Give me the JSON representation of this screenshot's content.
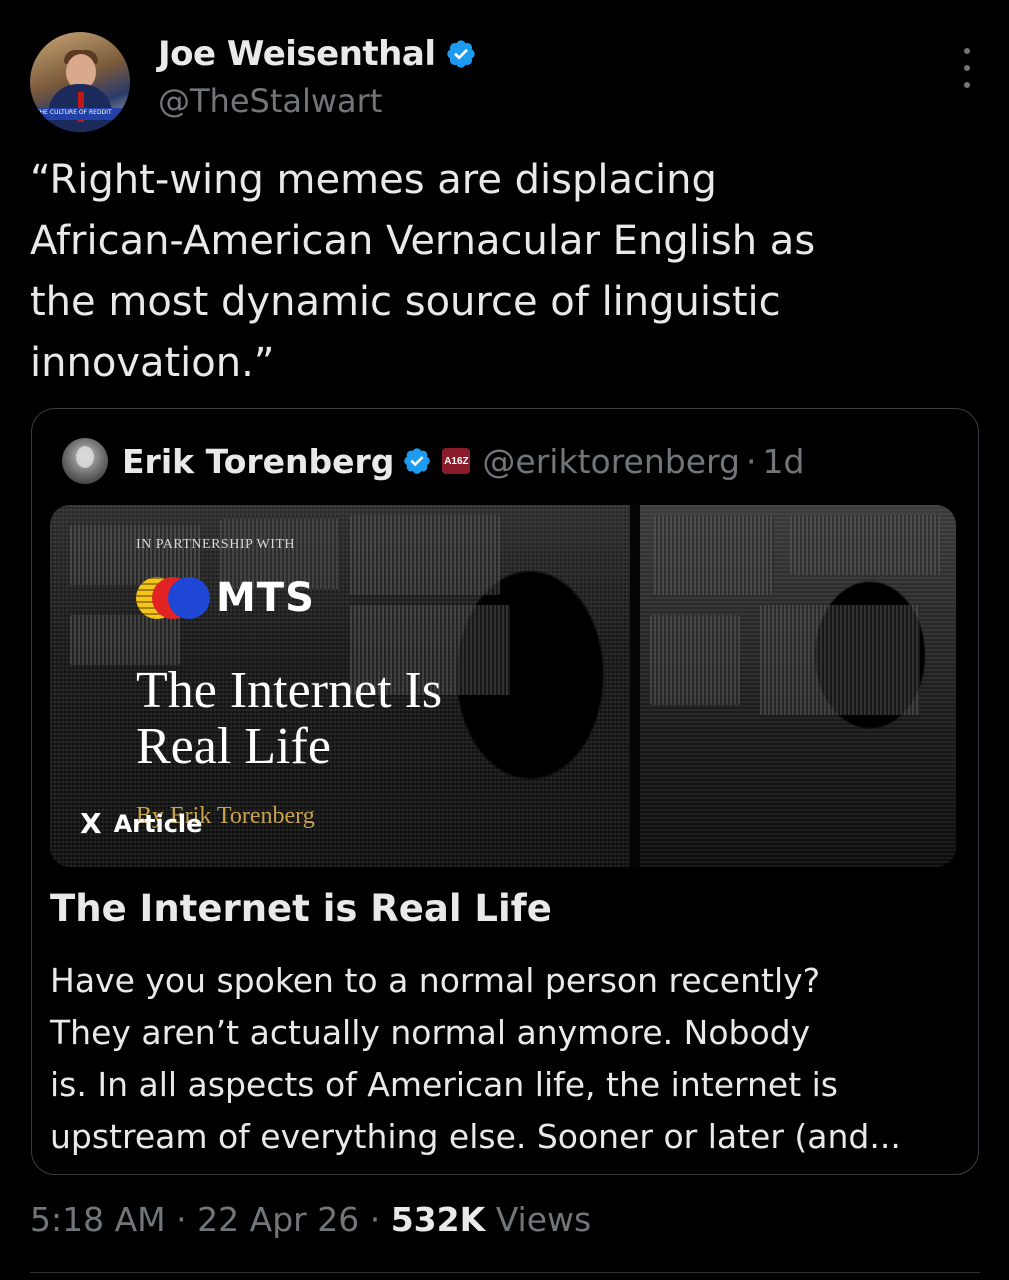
{
  "author": {
    "name": "Joe Weisenthal",
    "handle": "@TheStalwart",
    "avatar_banner_text": "THE CULTURE OF REDDIT"
  },
  "tweet": {
    "lines": [
      "“Right-wing memes are displacing",
      "African-American Vernacular English as",
      "the most dynamic source of linguistic",
      "innovation.”"
    ]
  },
  "quote": {
    "author_name": "Erik Torenberg",
    "affiliate_badge": "A16Z",
    "handle": "@eriktorenberg",
    "separator": "·",
    "age": "1d",
    "media": {
      "partner_text": "IN PARTNERSHIP WITH",
      "brand": "MTS",
      "headline_line1": "The Internet Is",
      "headline_line2": "Real Life",
      "byline": "By Erik Torenberg",
      "badge_logo": "X",
      "badge_label": "Article"
    },
    "title": "The Internet is Real Life",
    "body_lines": [
      "Have you spoken to a normal person recently?",
      "They aren’t actually normal anymore. Nobody",
      "is. In all aspects of American life, the internet is",
      "upstream of everything else. Sooner or later (and..."
    ]
  },
  "meta": {
    "time": "5:18 AM",
    "date": "22 Apr 26",
    "views_count": "532K",
    "views_label": "Views",
    "separator": "·"
  },
  "colors": {
    "background": "#000000",
    "text_primary": "#e7e9ea",
    "text_secondary": "#71767b",
    "verified": "#1d9bf0",
    "border": "#3a3d42"
  },
  "icons": {
    "verified": "verified-badge-icon",
    "more": "more-vertical-icon",
    "x_logo": "x-logo-icon"
  }
}
